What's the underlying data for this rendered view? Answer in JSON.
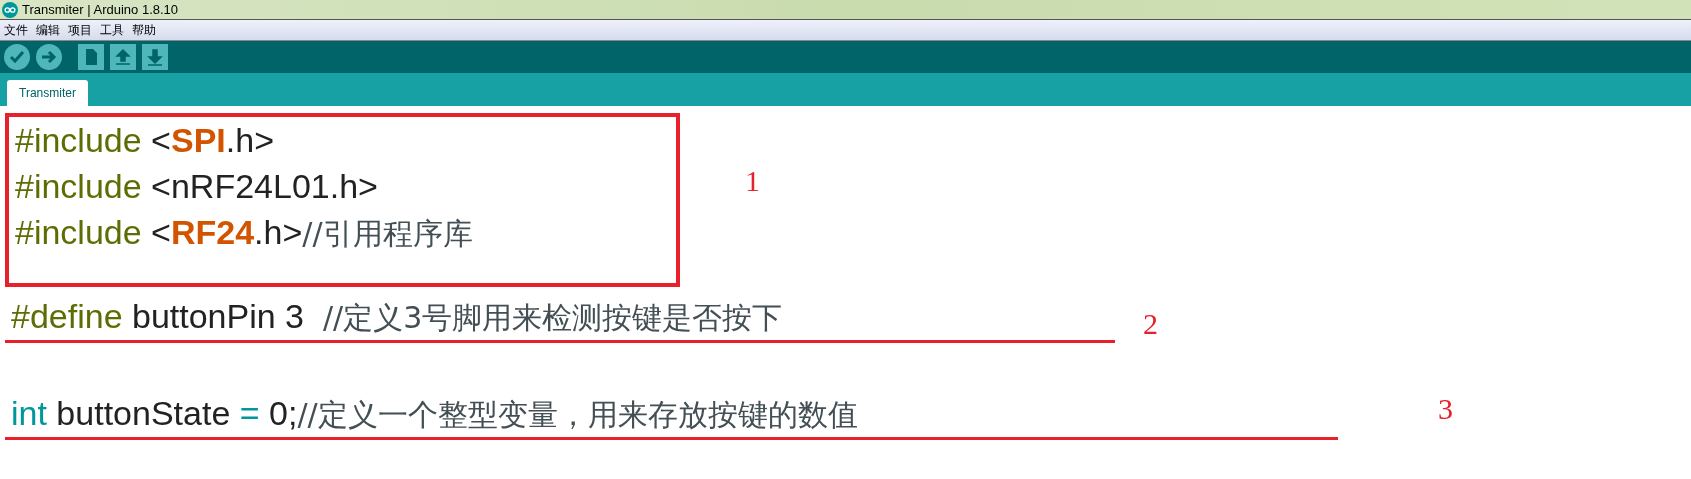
{
  "window": {
    "title": "Transmiter | Arduino 1.8.10"
  },
  "menu": [
    "文件",
    "编辑",
    "项目",
    "工具",
    "帮助"
  ],
  "toolbar": [
    {
      "kind": "verify"
    },
    {
      "kind": "upload"
    },
    {
      "kind": "new"
    },
    {
      "kind": "open"
    },
    {
      "kind": "save"
    }
  ],
  "tabs": [
    {
      "label": "Transmiter",
      "selected": true
    }
  ],
  "annotations": [
    {
      "kind": "box",
      "label": "1",
      "lines": [
        {
          "tokens": [
            {
              "kind": "keyword",
              "text": "#include"
            },
            {
              "kind": "plain",
              "text": " <"
            },
            {
              "kind": "library",
              "text": "SPI"
            },
            {
              "kind": "plain",
              "text": ".h>"
            }
          ]
        },
        {
          "tokens": [
            {
              "kind": "keyword",
              "text": "#include"
            },
            {
              "kind": "plain",
              "text": " <nRF24L01.h>"
            }
          ]
        },
        {
          "tokens": [
            {
              "kind": "keyword",
              "text": "#include"
            },
            {
              "kind": "plain",
              "text": " <"
            },
            {
              "kind": "library",
              "text": "RF24"
            },
            {
              "kind": "plain",
              "text": ".h>"
            },
            {
              "kind": "comment",
              "text": "//引用程序库"
            }
          ]
        }
      ]
    },
    {
      "kind": "underline",
      "label": "2",
      "lines": [
        {
          "tokens": [
            {
              "kind": "keyword",
              "text": "#define"
            },
            {
              "kind": "plain",
              "text": " buttonPin 3  "
            },
            {
              "kind": "comment",
              "text": "//定义3号脚用来检测按键是否按下"
            }
          ]
        }
      ]
    },
    {
      "kind": "underline",
      "label": "3",
      "lines": [
        {
          "tokens": [
            {
              "kind": "type",
              "text": "int"
            },
            {
              "kind": "plain",
              "text": " buttonState "
            },
            {
              "kind": "type",
              "text": "="
            },
            {
              "kind": "plain",
              "text": " 0;"
            },
            {
              "kind": "comment",
              "text": "//定义一个整型变量，用来存放按键的数值"
            }
          ]
        }
      ]
    }
  ]
}
